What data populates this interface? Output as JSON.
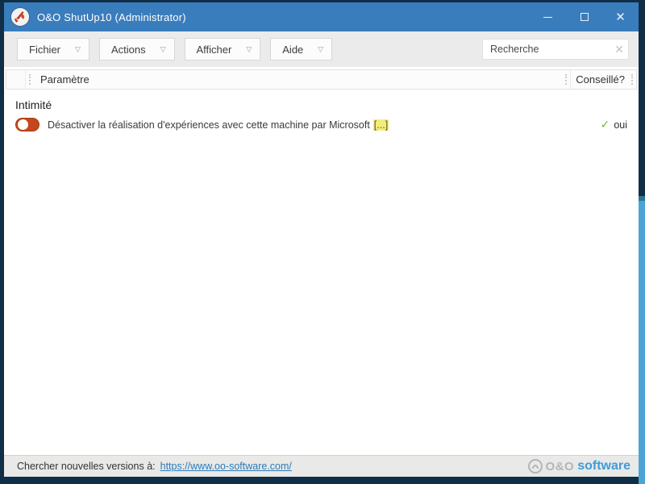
{
  "window": {
    "title": "O&O ShutUp10 (Administrator)"
  },
  "menubar": {
    "items": [
      {
        "label": "Fichier"
      },
      {
        "label": "Actions"
      },
      {
        "label": "Afficher"
      },
      {
        "label": "Aide"
      }
    ],
    "search_placeholder": "Recherche"
  },
  "table": {
    "columns": [
      {
        "label": "Paramètre"
      },
      {
        "label": "Conseillé?"
      }
    ]
  },
  "content": {
    "section_title": "Intimité",
    "rows": [
      {
        "label": "Désactiver la réalisation d'expériences avec cette machine par Microsoft",
        "label_suffix": "[...]",
        "toggle_state": "off",
        "recommended": "oui"
      }
    ]
  },
  "footer": {
    "update_text": "Chercher nouvelles versions à:",
    "update_link": "https://www.oo-software.com/",
    "brand_prefix": "O&O",
    "brand_suffix": "software"
  },
  "colors": {
    "titlebar": "#3a7dbd",
    "window_border": "#112e47",
    "toggle_off": "#c5471d",
    "highlight": "#f3ee7c",
    "check_green": "#76b82a",
    "link_blue": "#2b7bba",
    "brand_blue": "#3f9bd8",
    "edge_blue": "#4aa4d6"
  }
}
